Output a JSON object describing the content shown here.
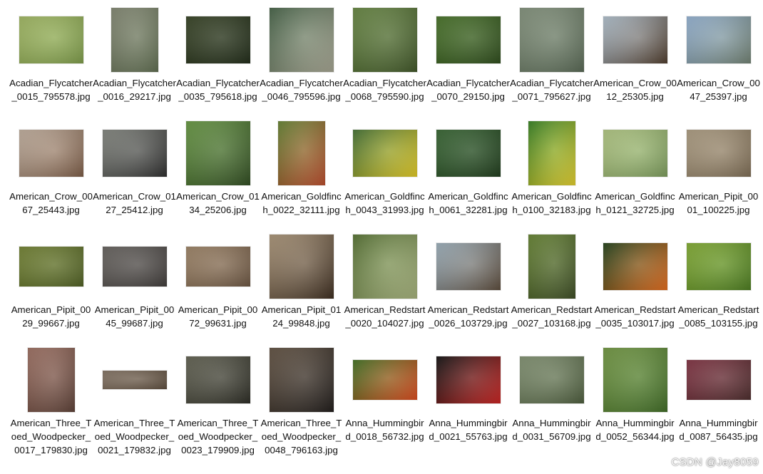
{
  "files": [
    {
      "name": "Acadian_Flycatcher_0015_795578.jpg",
      "shape": "l",
      "c1": "#a9c06a",
      "c2": "#7c9a48"
    },
    {
      "name": "Acadian_Flycatcher_0016_29217.jpg",
      "shape": "p",
      "c1": "#8a8f7a",
      "c2": "#5d6b4e"
    },
    {
      "name": "Acadian_Flycatcher_0035_795618.jpg",
      "shape": "l",
      "c1": "#3e4a2c",
      "c2": "#1f2a17"
    },
    {
      "name": "Acadian_Flycatcher_0046_795596.jpg",
      "shape": "s",
      "c1": "#4e6b4f",
      "c2": "#a3a28f"
    },
    {
      "name": "Acadian_Flycatcher_0068_795590.jpg",
      "shape": "s",
      "c1": "#6f8f4a",
      "c2": "#3e5426"
    },
    {
      "name": "Acadian_Flycatcher_0070_29150.jpg",
      "shape": "l",
      "c1": "#4f7a2f",
      "c2": "#2c4a1a"
    },
    {
      "name": "Acadian_Flycatcher_0071_795627.jpg",
      "shape": "s",
      "c1": "#8b9a84",
      "c2": "#566652"
    },
    {
      "name": "American_Crow_0012_25305.jpg",
      "shape": "l",
      "c1": "#b9c9d6",
      "c2": "#4d3a2a"
    },
    {
      "name": "American_Crow_0047_25397.jpg",
      "shape": "l",
      "c1": "#9dbbdc",
      "c2": "#6f7f70"
    },
    {
      "name": "American_Crow_0067_25443.jpg",
      "shape": "l",
      "c1": "#c9b7a6",
      "c2": "#7a5a44"
    },
    {
      "name": "American_Crow_0127_25412.jpg",
      "shape": "l",
      "c1": "#8c8f88",
      "c2": "#2b2b2b"
    },
    {
      "name": "American_Crow_0134_25206.jpg",
      "shape": "s",
      "c1": "#6fa04a",
      "c2": "#2e4a1f"
    },
    {
      "name": "American_Goldfinch_0022_32111.jpg",
      "shape": "p",
      "c1": "#6d8b3a",
      "c2": "#b84a2a"
    },
    {
      "name": "American_Goldfinch_0043_31993.jpg",
      "shape": "l",
      "c1": "#4c7a3c",
      "c2": "#e0c822"
    },
    {
      "name": "American_Goldfinch_0061_32281.jpg",
      "shape": "l",
      "c1": "#3f6e3a",
      "c2": "#1d3a1a"
    },
    {
      "name": "American_Goldfinch_0100_32183.jpg",
      "shape": "p",
      "c1": "#3e8a2a",
      "c2": "#e0cc2a"
    },
    {
      "name": "American_Goldfinch_0121_32725.jpg",
      "shape": "l",
      "c1": "#b9cf8a",
      "c2": "#7a9a5a"
    },
    {
      "name": "American_Pipit_0001_100225.jpg",
      "shape": "l",
      "c1": "#b5a58a",
      "c2": "#7b6a52"
    },
    {
      "name": "American_Pipit_0029_99667.jpg",
      "shape": "w",
      "c1": "#7a8a3a",
      "c2": "#4e5e22"
    },
    {
      "name": "American_Pipit_0045_99687.jpg",
      "shape": "w",
      "c1": "#6e6a66",
      "c2": "#3e3a38"
    },
    {
      "name": "American_Pipit_0072_99631.jpg",
      "shape": "w",
      "c1": "#a58b6e",
      "c2": "#6a5440"
    },
    {
      "name": "American_Pipit_0124_99848.jpg",
      "shape": "s",
      "c1": "#b39d80",
      "c2": "#3a2a1c"
    },
    {
      "name": "American_Redstart_0020_104027.jpg",
      "shape": "s",
      "c1": "#5e7a3a",
      "c2": "#a4b07a"
    },
    {
      "name": "American_Redstart_0026_103729.jpg",
      "shape": "l",
      "c1": "#a5b8c4",
      "c2": "#5a4a3a"
    },
    {
      "name": "American_Redstart_0027_103168.jpg",
      "shape": "p",
      "c1": "#6e8c3a",
      "c2": "#3a4a22"
    },
    {
      "name": "American_Redstart_0035_103017.jpg",
      "shape": "l",
      "c1": "#2a4a22",
      "c2": "#e26a1a"
    },
    {
      "name": "American_Redstart_0085_103155.jpg",
      "shape": "l",
      "c1": "#8ab43a",
      "c2": "#4a7a1e"
    },
    {
      "name": "American_Three_Toed_Woodpecker_0017_179830.jpg",
      "shape": "p",
      "c1": "#a6786a",
      "c2": "#5a3e34"
    },
    {
      "name": "American_Three_Toed_Woodpecker_0021_179832.jpg",
      "shape": "t",
      "c1": "#8a7a6a",
      "c2": "#5a4a3a"
    },
    {
      "name": "American_Three_Toed_Woodpecker_0023_179909.jpg",
      "shape": "l",
      "c1": "#6a6a5a",
      "c2": "#2a2a22"
    },
    {
      "name": "American_Three_Toed_Woodpecker_0048_796163.jpg",
      "shape": "s",
      "c1": "#6a5a4a",
      "c2": "#1e1a18"
    },
    {
      "name": "Anna_Hummingbird_0018_56732.jpg",
      "shape": "w",
      "c1": "#4a7a2a",
      "c2": "#d9481a"
    },
    {
      "name": "Anna_Hummingbird_0021_55763.jpg",
      "shape": "l",
      "c1": "#1a1a1a",
      "c2": "#c8201e"
    },
    {
      "name": "Anna_Hummingbird_0031_56709.jpg",
      "shape": "l",
      "c1": "#8a9a7a",
      "c2": "#4a5a3a"
    },
    {
      "name": "Anna_Hummingbird_0052_56344.jpg",
      "shape": "s",
      "c1": "#7aa04a",
      "c2": "#3e6a24"
    },
    {
      "name": "Anna_Hummingbird_0087_56435.jpg",
      "shape": "w",
      "c1": "#8a3a4a",
      "c2": "#4a2a2a"
    }
  ],
  "watermark": "CSDN @Jay8059"
}
